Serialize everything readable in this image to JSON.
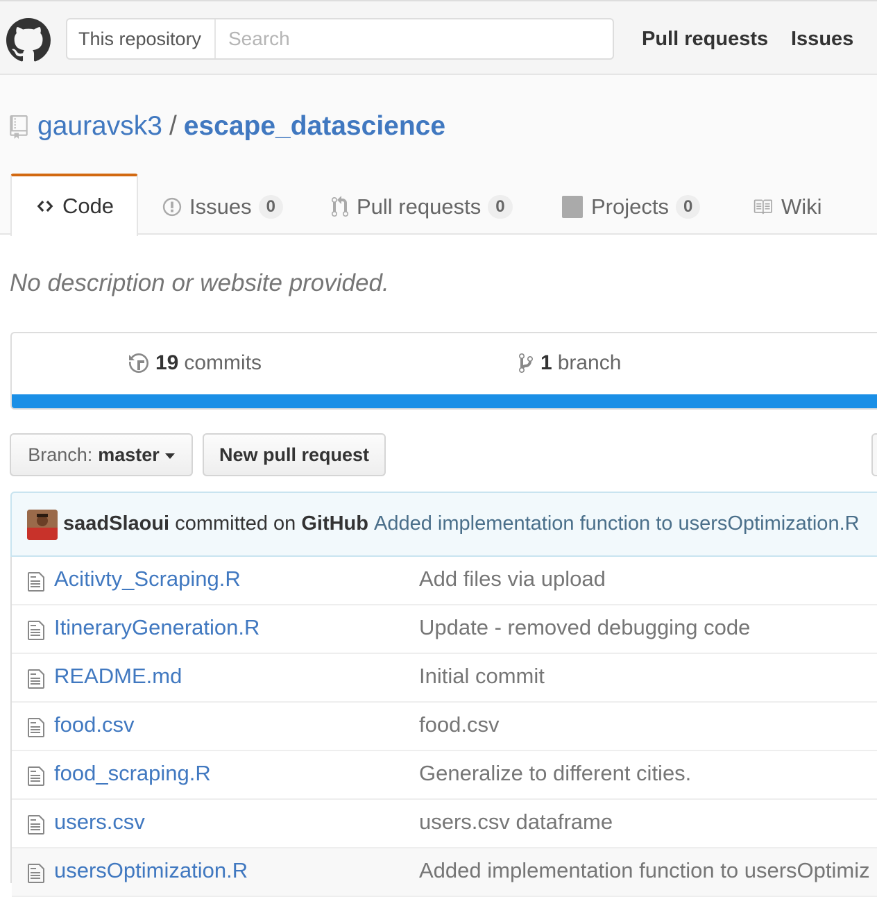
{
  "header": {
    "scope_label": "This repository",
    "search_placeholder": "Search",
    "nav": [
      "Pull requests",
      "Issues"
    ]
  },
  "repo": {
    "owner": "gauravsk3",
    "separator": "/",
    "name": "escape_datascience",
    "description": "No description or website provided."
  },
  "tabs": [
    {
      "label": "Code"
    },
    {
      "label": "Issues",
      "count": "0"
    },
    {
      "label": "Pull requests",
      "count": "0"
    },
    {
      "label": "Projects",
      "count": "0"
    },
    {
      "label": "Wiki"
    }
  ],
  "summary": {
    "commits_count": "19",
    "commits_label": "commits",
    "branch_count": "1",
    "branch_label": "branch",
    "language_color": "#1a8fe6"
  },
  "toolbar": {
    "branch_prefix": "Branch:",
    "branch_name": "master",
    "new_pr_label": "New pull request"
  },
  "latest_commit": {
    "author": "saadSlaoui",
    "middle": "committed on",
    "via": "GitHub",
    "message": "Added implementation function to usersOptimization.R"
  },
  "files": [
    {
      "name": "Acitivty_Scraping.R",
      "message": "Add files via upload"
    },
    {
      "name": "ItineraryGeneration.R",
      "message": "Update - removed debugging code"
    },
    {
      "name": "README.md",
      "message": "Initial commit"
    },
    {
      "name": "food.csv",
      "message": "food.csv"
    },
    {
      "name": "food_scraping.R",
      "message": "Generalize to different cities."
    },
    {
      "name": "users.csv",
      "message": "users.csv dataframe"
    },
    {
      "name": "usersOptimization.R",
      "message": "Added implementation function to usersOptimiz"
    }
  ]
}
